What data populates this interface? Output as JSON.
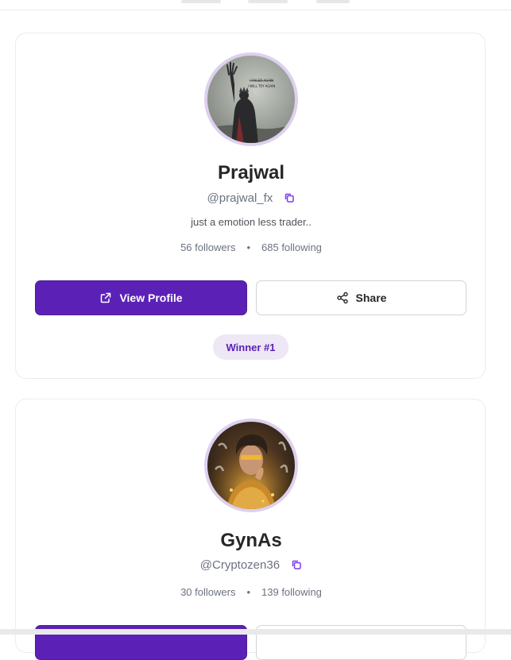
{
  "profiles": [
    {
      "name": "Prajwal",
      "handle": "@prajwal_fx",
      "bio": "just a emotion less trader..",
      "followers": "56 followers",
      "following": "685 following",
      "view_profile_label": "View Profile",
      "share_label": "Share",
      "badge": "Winner #1",
      "avatar_caption_top": "I FAILED AGAIN",
      "avatar_caption_bottom": "I WILL TRY AGAIN"
    },
    {
      "name": "GynAs",
      "handle": "@Cryptozen36",
      "followers": "30 followers",
      "following": "139 following"
    }
  ],
  "stat_separator": "•",
  "colors": {
    "primary": "#5b21b6",
    "badge_bg": "#ede7f6",
    "avatar_ring": "#ddd0ef"
  },
  "icons": {
    "copy": "copy-icon",
    "external_link": "external-link-icon",
    "share": "share-icon"
  }
}
